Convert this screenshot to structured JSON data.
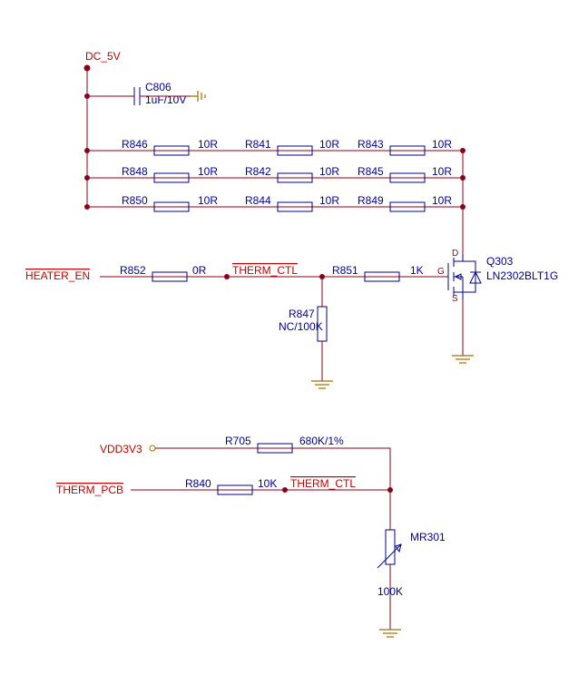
{
  "power": {
    "dc5v": "DC_5V",
    "vdd3v3": "VDD3V3"
  },
  "nets": {
    "heater_en": "HEATER_EN",
    "therm_ctl_upper": "THERM_CTL",
    "therm_pcb": "THERM_PCB",
    "therm_ctl_lower": "THERM_CTL"
  },
  "components": {
    "C806": {
      "ref": "C806",
      "val": "1uF/10V"
    },
    "R846": {
      "ref": "R846",
      "val": "10R"
    },
    "R841": {
      "ref": "R841",
      "val": "10R"
    },
    "R843": {
      "ref": "R843",
      "val": "10R"
    },
    "R848": {
      "ref": "R848",
      "val": "10R"
    },
    "R842": {
      "ref": "R842",
      "val": "10R"
    },
    "R845": {
      "ref": "R845",
      "val": "10R"
    },
    "R850": {
      "ref": "R850",
      "val": "10R"
    },
    "R844": {
      "ref": "R844",
      "val": "10R"
    },
    "R849": {
      "ref": "R849",
      "val": "10R"
    },
    "R852": {
      "ref": "R852",
      "val": "0R"
    },
    "R851": {
      "ref": "R851",
      "val": "1K"
    },
    "R847": {
      "ref": "R847",
      "val": "NC/100K"
    },
    "Q303": {
      "ref": "Q303",
      "val": "LN2302BLT1G",
      "pins": {
        "d": "D",
        "g": "G",
        "s": "S"
      }
    },
    "R705": {
      "ref": "R705",
      "val": "680K/1%"
    },
    "R840": {
      "ref": "R840",
      "val": "10K"
    },
    "MR301": {
      "ref": "MR301",
      "val": "100K"
    }
  }
}
